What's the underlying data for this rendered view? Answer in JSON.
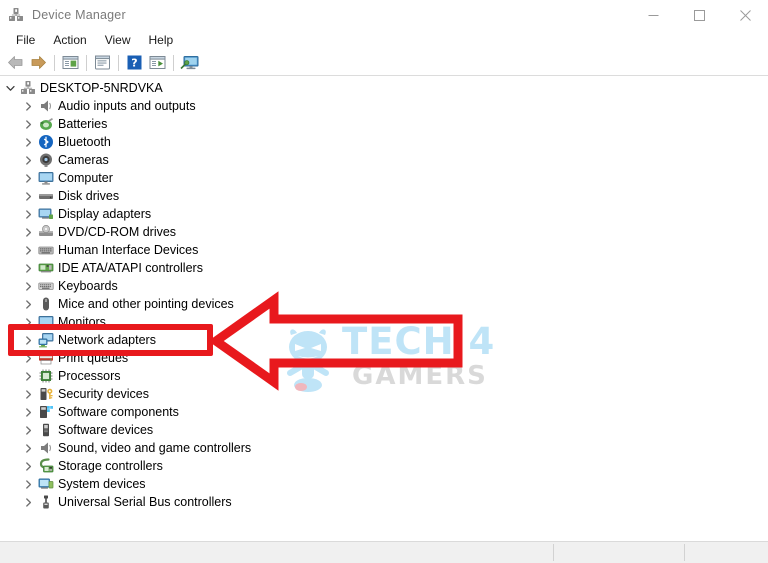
{
  "window": {
    "title": "Device Manager",
    "title_icon": "device-manager-icon",
    "controls": [
      {
        "name": "minimize-button",
        "glyph": "minimize-icon"
      },
      {
        "name": "maximize-button",
        "glyph": "maximize-icon"
      },
      {
        "name": "close-button",
        "glyph": "close-icon"
      }
    ]
  },
  "menubar": {
    "items": [
      {
        "label": "File"
      },
      {
        "label": "Action"
      },
      {
        "label": "View"
      },
      {
        "label": "Help"
      }
    ]
  },
  "toolbar": {
    "items": [
      {
        "type": "button",
        "name": "back-button",
        "icon": "back-arrow-icon"
      },
      {
        "type": "button",
        "name": "forward-button",
        "icon": "forward-arrow-icon"
      },
      {
        "type": "separator"
      },
      {
        "type": "button",
        "name": "show-hidden-devices-button",
        "icon": "window-list-icon"
      },
      {
        "type": "separator"
      },
      {
        "type": "button",
        "name": "properties-button",
        "icon": "properties-icon"
      },
      {
        "type": "separator"
      },
      {
        "type": "button",
        "name": "help-button",
        "icon": "help-question-icon"
      },
      {
        "type": "button",
        "name": "update-driver-button",
        "icon": "window-play-icon"
      },
      {
        "type": "separator"
      },
      {
        "type": "button",
        "name": "scan-hardware-changes-button",
        "icon": "monitor-scan-icon"
      }
    ]
  },
  "tree": {
    "root": {
      "label": "DESKTOP-5NRDVKA",
      "icon": "computer-root-icon",
      "expanded": true
    },
    "nodes": [
      {
        "label": "Audio inputs and outputs",
        "icon": "speaker-icon"
      },
      {
        "label": "Batteries",
        "icon": "battery-icon"
      },
      {
        "label": "Bluetooth",
        "icon": "bluetooth-icon"
      },
      {
        "label": "Cameras",
        "icon": "camera-icon"
      },
      {
        "label": "Computer",
        "icon": "monitor-icon"
      },
      {
        "label": "Disk drives",
        "icon": "disk-drive-icon"
      },
      {
        "label": "Display adapters",
        "icon": "display-adapter-icon"
      },
      {
        "label": "DVD/CD-ROM drives",
        "icon": "optical-drive-icon"
      },
      {
        "label": "Human Interface Devices",
        "icon": "hid-icon"
      },
      {
        "label": "IDE ATA/ATAPI controllers",
        "icon": "ide-controller-icon"
      },
      {
        "label": "Keyboards",
        "icon": "keyboard-icon"
      },
      {
        "label": "Mice and other pointing devices",
        "icon": "mouse-icon"
      },
      {
        "label": "Monitors",
        "icon": "monitor-icon"
      },
      {
        "label": "Network adapters",
        "icon": "network-adapter-icon",
        "highlighted": true
      },
      {
        "label": "Print queues",
        "icon": "printer-icon"
      },
      {
        "label": "Processors",
        "icon": "processor-icon"
      },
      {
        "label": "Security devices",
        "icon": "security-device-icon"
      },
      {
        "label": "Software components",
        "icon": "software-component-icon"
      },
      {
        "label": "Software devices",
        "icon": "software-device-icon"
      },
      {
        "label": "Sound, video and game controllers",
        "icon": "speaker-icon"
      },
      {
        "label": "Storage controllers",
        "icon": "storage-controller-icon"
      },
      {
        "label": "System devices",
        "icon": "system-device-icon"
      },
      {
        "label": "Universal Serial Bus controllers",
        "icon": "usb-icon"
      }
    ]
  },
  "annotations": {
    "highlight_box": {
      "name": "network-adapters-highlight-box",
      "color": "#e8191d"
    },
    "pointer_arrow": {
      "name": "red-pointer-arrow",
      "color": "#e8191d",
      "direction": "left"
    }
  },
  "watermark": {
    "mascot": "tech4gamers-mascot-icon",
    "line1": "TECH 4",
    "line2": "GAMERS",
    "color_primary": "#bfe4f7",
    "color_secondary": "#d9d9d9"
  },
  "statusbar": {
    "text": ""
  },
  "colors": {
    "accent_red": "#e8191d",
    "window_bg": "#ffffff",
    "status_bg": "#f0f0f0"
  }
}
